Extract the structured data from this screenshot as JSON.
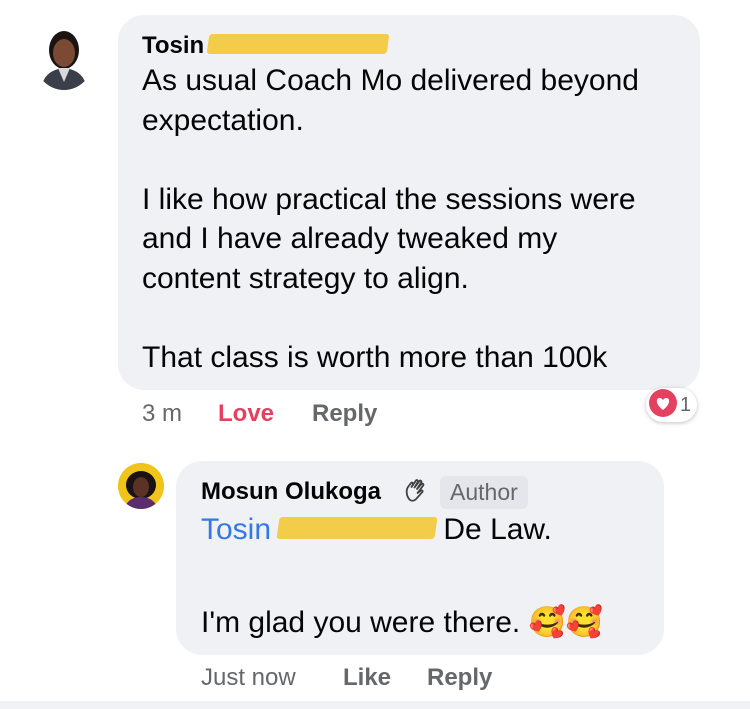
{
  "comment": {
    "author_first": "Tosin",
    "text": "As usual Coach Mo delivered beyond\nexpectation.\n\nI like how practical the sessions were\nand I have already tweaked my\ncontent strategy to align.\n\nThat class is worth more than 100k",
    "time": "3 m",
    "love_label": "Love",
    "reply_label": "Reply",
    "reaction": {
      "icon": "heart-icon",
      "count": "1",
      "color": "#e4405f"
    }
  },
  "reply": {
    "author": "Mosun Olukoga",
    "author_badge": "Author",
    "mention_first": "Tosin",
    "mention_suffix": " De Law.",
    "text": "I'm glad you were there.",
    "emoji": "🥰🥰",
    "time": "Just now",
    "like_label": "Like",
    "reply_label": "Reply"
  },
  "colors": {
    "bubble": "#eff1f4",
    "redaction": "#f3cd4a",
    "mention": "#3578e5"
  }
}
